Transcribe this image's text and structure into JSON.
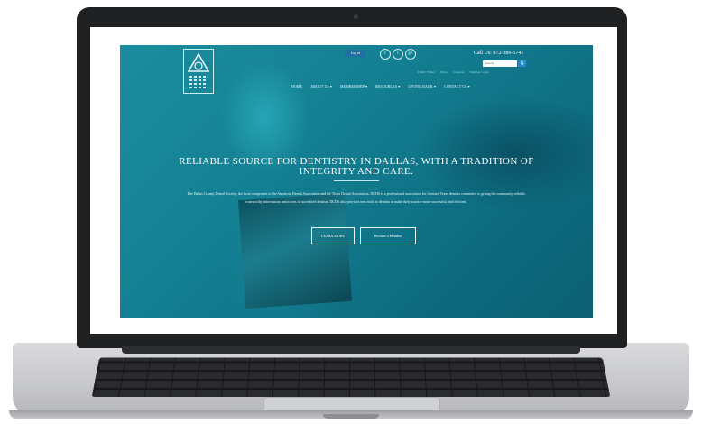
{
  "header": {
    "login_label": "Log in",
    "social": [
      "f",
      "t",
      "g+"
    ],
    "phone": "Call Us: 972-386-5741",
    "search_placeholder": "Search...",
    "search_button": "Q",
    "utility_links": [
      "Public Finder",
      "News",
      "Calendar",
      "Member Login"
    ]
  },
  "nav": {
    "items": [
      "HOME",
      "ABOUT US ▾",
      "MEMBERSHIP ▾",
      "RESOURCES ▾",
      "GIVING BACK ▾",
      "CONTACT US ▾"
    ]
  },
  "hero": {
    "title": "RELIABLE SOURCE FOR DENTISTRY IN DALLAS, WITH A TRADITION OF INTEGRITY AND CARE.",
    "description": "The Dallas County Dental Society, the local component to the American Dental Association and the Texas Dental Association. DCDS is a professional association for licensed Texas dentists committed to giving the community reliable, trustworthy information and access to accredited dentists. DCDS also provides new tools to dentists to make their practice more successful, and efficient.",
    "learn_more": "LEARN MORE",
    "become_member": "Become a Member"
  },
  "colors": {
    "hero_teal": "#147f92",
    "login_blue": "#1f6fa0",
    "search_blue": "#2b88c6"
  }
}
